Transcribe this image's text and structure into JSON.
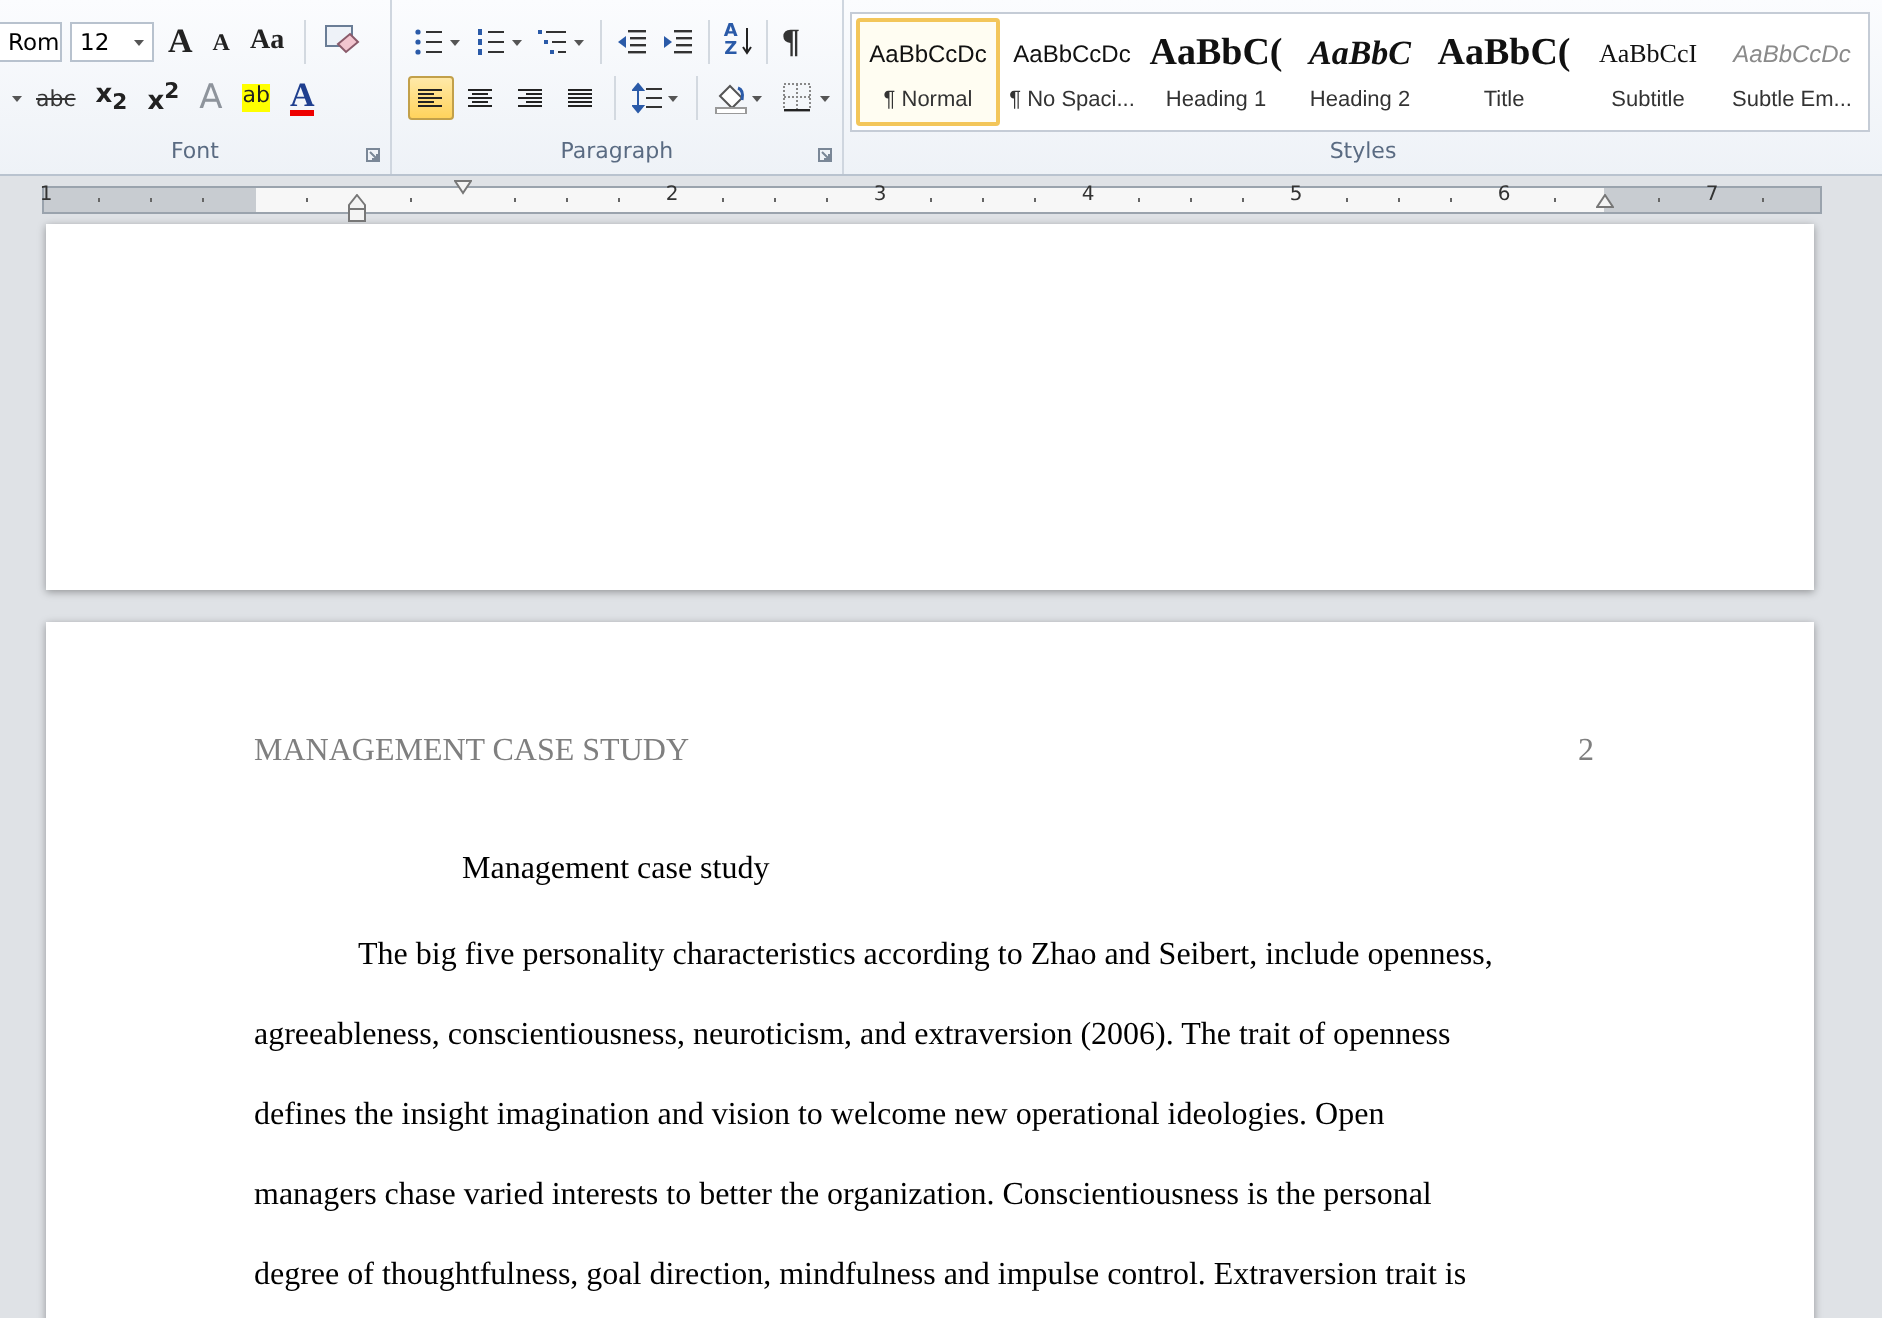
{
  "font_group": {
    "label": "Font",
    "font_name": "Rom",
    "font_size": "12",
    "row1_glyphs": [
      {
        "kind": "grow",
        "text": "A"
      },
      {
        "kind": "shrink",
        "text": "A"
      },
      {
        "kind": "case",
        "text": "Aa"
      }
    ],
    "row2_glyphs": [
      {
        "kind": "strike",
        "text": "abc"
      },
      {
        "kind": "sub",
        "text": "x$_{2}$"
      },
      {
        "kind": "sup",
        "text": "x$^{2}$"
      },
      {
        "kind": "effects",
        "text": "A"
      },
      {
        "kind": "highlight",
        "text": "ab"
      },
      {
        "kind": "color",
        "text": "A"
      }
    ]
  },
  "paragraph_group": {
    "label": "Paragraph",
    "sort_glyph": "AZ",
    "marks_glyph": "¶",
    "alignments": [
      {
        "kind": "left",
        "selected": true
      },
      {
        "kind": "center",
        "selected": false
      },
      {
        "kind": "right",
        "selected": false
      },
      {
        "kind": "justify",
        "selected": false
      }
    ]
  },
  "styles_group": {
    "label": "Styles",
    "items": [
      {
        "preview": "AaBbCcDc",
        "label": "¶ Normal",
        "kind": "normal",
        "selected": true
      },
      {
        "preview": "AaBbCcDc",
        "label": "¶ No Spaci...",
        "kind": "normal",
        "selected": false
      },
      {
        "preview": "AaBbC(",
        "label": "Heading 1",
        "kind": "heading1",
        "selected": false
      },
      {
        "preview": "AaBbC",
        "label": "Heading 2",
        "kind": "heading2",
        "selected": false
      },
      {
        "preview": "AaBbC(",
        "label": "Title",
        "kind": "title",
        "selected": false
      },
      {
        "preview": "AaBbCcI",
        "label": "Subtitle",
        "kind": "subtitle",
        "selected": false
      },
      {
        "preview": "AaBbCcDc",
        "label": "Subtle Em...",
        "kind": "subtle",
        "selected": false
      }
    ]
  },
  "ruler": {
    "labels": [
      "1",
      "2",
      "3",
      "4",
      "5",
      "6",
      "7"
    ]
  },
  "page": {
    "header": "MANAGEMENT CASE STUDY",
    "page_number": "2",
    "title": "Management case study",
    "lines": [
      "The big five personality characteristics according to Zhao and Seibert, include openness,",
      "agreeableness, conscientiousness, neuroticism, and extraversion (2006). The trait of openness",
      "defines the insight imagination and vision to welcome new operational ideologies. Open",
      "managers chase varied interests to better the organization. Conscientiousness is the personal",
      "degree of thoughtfulness, goal direction, mindfulness and impulse control. Extraversion trait is"
    ]
  }
}
